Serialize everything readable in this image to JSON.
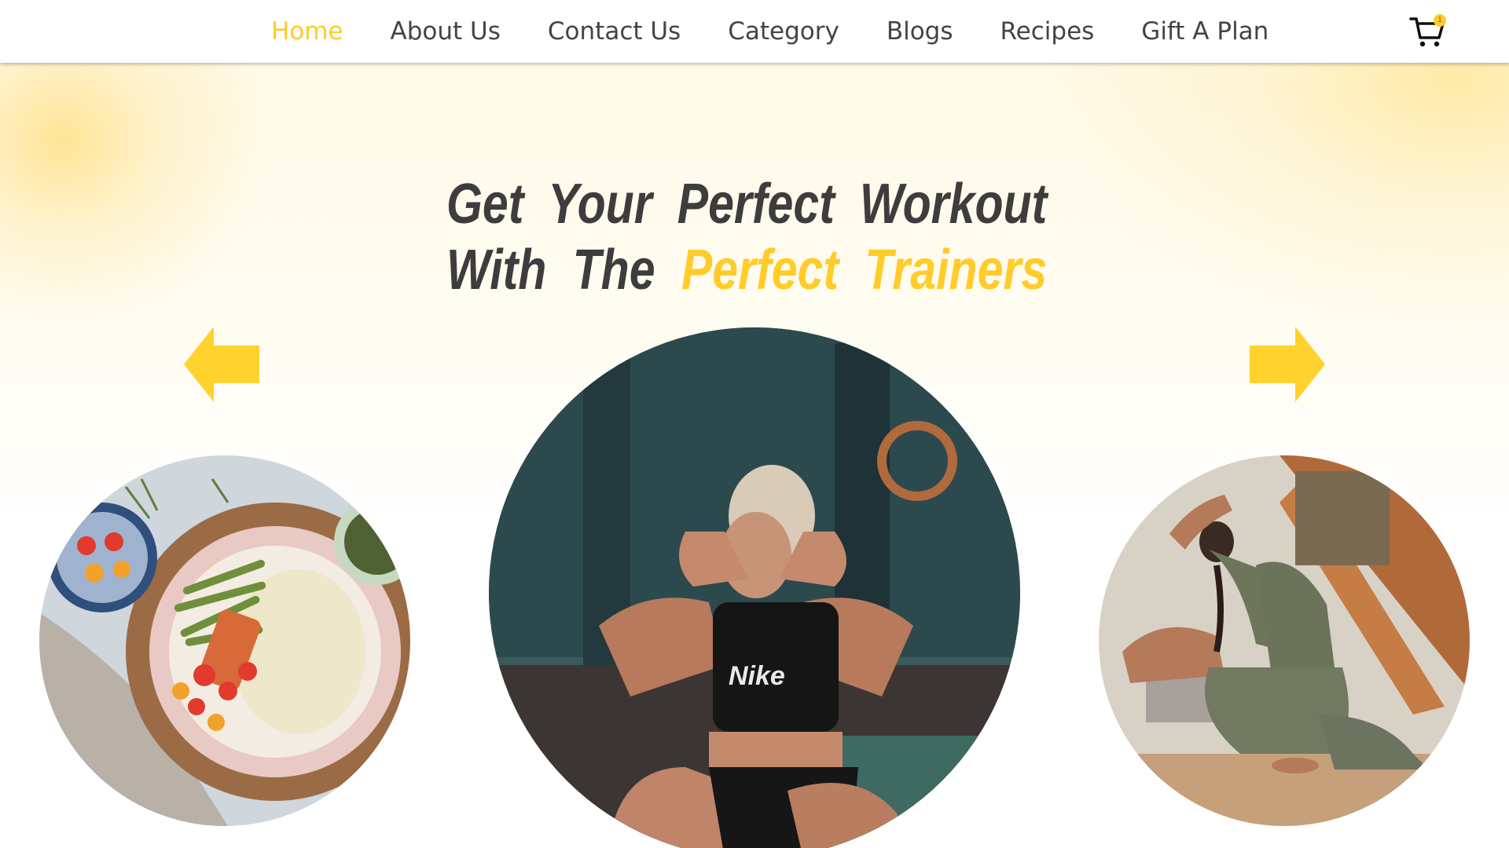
{
  "nav": {
    "items": [
      {
        "label": "Home",
        "active": true
      },
      {
        "label": "About Us",
        "active": false
      },
      {
        "label": "Contact Us",
        "active": false
      },
      {
        "label": "Category",
        "active": false
      },
      {
        "label": "Blogs",
        "active": false
      },
      {
        "label": "Recipes",
        "active": false
      },
      {
        "label": "Gift A Plan",
        "active": false
      }
    ],
    "cart_icon": "shopping-cart-icon",
    "cart_count": "1"
  },
  "hero": {
    "headline": {
      "line1": "Get Your Perfect Workout",
      "line2_plain": "With The ",
      "line2_accent": "Perfect Trainers"
    },
    "prev_icon": "arrow-left-icon",
    "next_icon": "arrow-right-icon",
    "slides": [
      {
        "name": "healthy-meal-bowl-image"
      },
      {
        "name": "woman-doing-situps-image"
      },
      {
        "name": "yoga-pose-image"
      }
    ]
  },
  "colors": {
    "accent": "#FFCC29",
    "text_dark": "#3d3d3d",
    "nav_text": "#444444"
  }
}
